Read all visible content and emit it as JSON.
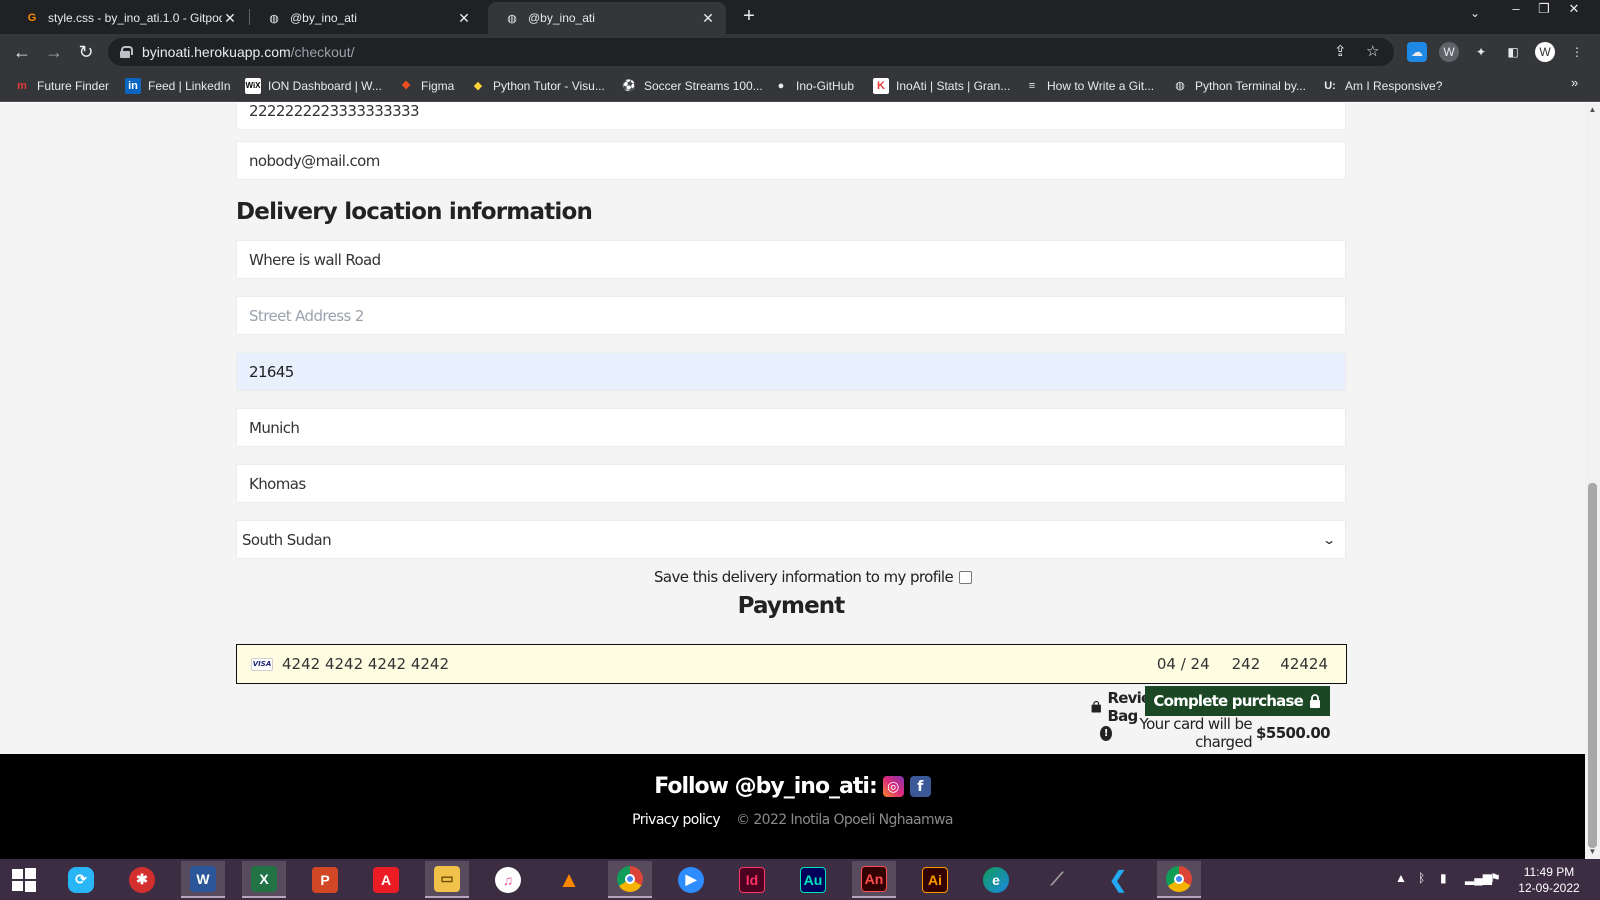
{
  "browser": {
    "tabs": [
      {
        "title": "style.css - by_ino_ati.1.0 - Gitpod",
        "icon": "gitpod-icon",
        "active": false
      },
      {
        "title": "@by_ino_ati",
        "icon": "globe-icon",
        "active": false
      },
      {
        "title": "@by_ino_ati",
        "icon": "globe-icon",
        "active": true
      }
    ],
    "url_host": "byinoati.herokuapp.com",
    "url_path": "/checkout/",
    "bookmarks": [
      {
        "label": "Future Finder",
        "color": "#e53935"
      },
      {
        "label": "Feed | LinkedIn",
        "color": "#0a66c2"
      },
      {
        "label": "ION Dashboard | W...",
        "color": "#ffffff"
      },
      {
        "label": "Figma",
        "color": "#f24e1e"
      },
      {
        "label": "Python Tutor - Visu...",
        "color": "#ffd43b"
      },
      {
        "label": "Soccer Streams 100...",
        "color": "#ffffff"
      },
      {
        "label": "Ino-GitHub",
        "color": "#ffffff"
      },
      {
        "label": "InoAti | Stats | Gran...",
        "color": "#e53935"
      },
      {
        "label": "How to Write a Git...",
        "color": "#ffffff"
      },
      {
        "label": "Python Terminal by...",
        "color": "#bdbdbd"
      },
      {
        "label": "Am I Responsive?",
        "color": "#ffffff"
      }
    ]
  },
  "form": {
    "phone_value": "2222222223333333333",
    "email_value": "nobody@mail.com",
    "delivery_title": "Delivery location information",
    "street1_value": "Where is wall Road",
    "street2_placeholder": "Street Address 2",
    "postcode_value": "21645",
    "city_value": "Munich",
    "county_value": "Khomas",
    "country_value": "South Sudan",
    "save_label": "Save this delivery information to my profile"
  },
  "payment": {
    "title": "Payment",
    "card_brand": "VISA",
    "card_number": "4242 4242 4242 4242",
    "expiry": "04 / 24",
    "cvc": "242",
    "zip": "42424",
    "review_bag_label": "Review Bag",
    "complete_label": "Complete purchase",
    "charge_text": "Your card will be charged",
    "charge_amount": "$5500.00"
  },
  "footer": {
    "follow_text": "Follow @by_ino_ati:",
    "privacy_label": "Privacy policy",
    "copyright": "© 2022 Inotila Opoeli Nghaamwa"
  },
  "taskbar": {
    "apps": [
      {
        "name": "windows-start",
        "color": "#ffffff"
      },
      {
        "name": "shareit",
        "color": "#29b6f6"
      },
      {
        "name": "app-red",
        "color": "#d32f2f"
      },
      {
        "name": "word",
        "color": "#2b579a"
      },
      {
        "name": "excel",
        "color": "#217346"
      },
      {
        "name": "powerpoint",
        "color": "#d24726"
      },
      {
        "name": "acrobat",
        "color": "#ec1c24"
      },
      {
        "name": "file-explorer",
        "color": "#f0c24b"
      },
      {
        "name": "itunes",
        "color": "#e85a9c"
      },
      {
        "name": "vlc",
        "color": "#ff8800"
      },
      {
        "name": "chrome",
        "color": "#4285f4"
      },
      {
        "name": "zoom",
        "color": "#2d8cff"
      },
      {
        "name": "indesign",
        "color": "#ff3366"
      },
      {
        "name": "audition",
        "color": "#00e4bb"
      },
      {
        "name": "animate",
        "color": "#ff4d4d"
      },
      {
        "name": "illustrator",
        "color": "#ff9a00"
      },
      {
        "name": "edge",
        "color": "#0f9d58"
      },
      {
        "name": "app-dark",
        "color": "#6d6d6d"
      },
      {
        "name": "vscode",
        "color": "#007acc"
      },
      {
        "name": "chrome-2",
        "color": "#4285f4"
      }
    ],
    "time": "11:49 PM",
    "date": "12-09-2022"
  }
}
